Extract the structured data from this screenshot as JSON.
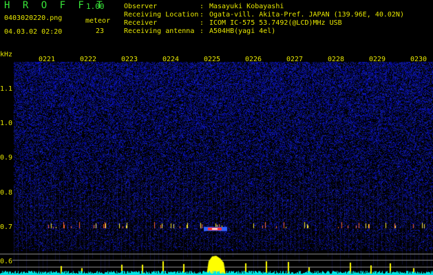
{
  "header": {
    "app_title": "H R O F F T",
    "version": "1.00",
    "file_name": "0403020220.png",
    "meteor_label": "meteor",
    "datetime": "04.03.02 02:20",
    "meteor_count": "23"
  },
  "info": [
    {
      "key": "Observer",
      "value": "Masayuki Kobayashi"
    },
    {
      "key": "Receiving Location",
      "value": "Ogata-vill. Akita-Pref. JAPAN (139.96E, 40.02N)"
    },
    {
      "key": "Receiver",
      "value": "ICOM IC-575 53.7492(@LCD)MHz USB"
    },
    {
      "key": "Receiving antenna",
      "value": "A504HB(yagi 4el)"
    }
  ],
  "spectrogram": {
    "unit_label": "kHz",
    "freq_labels": [
      "1.1",
      "1.0",
      "0.9",
      "0.8",
      "0.7",
      "0.6"
    ],
    "time_labels": [
      "0221",
      "0222",
      "0223",
      "0224",
      "0225",
      "0226",
      "0227",
      "0228",
      "0229",
      "0230"
    ],
    "colors": {
      "background": "#000000",
      "noise": "#1c1ca8",
      "signal": "#ff3030",
      "trace": "#00e5e5",
      "level": "#ffff00"
    }
  }
}
